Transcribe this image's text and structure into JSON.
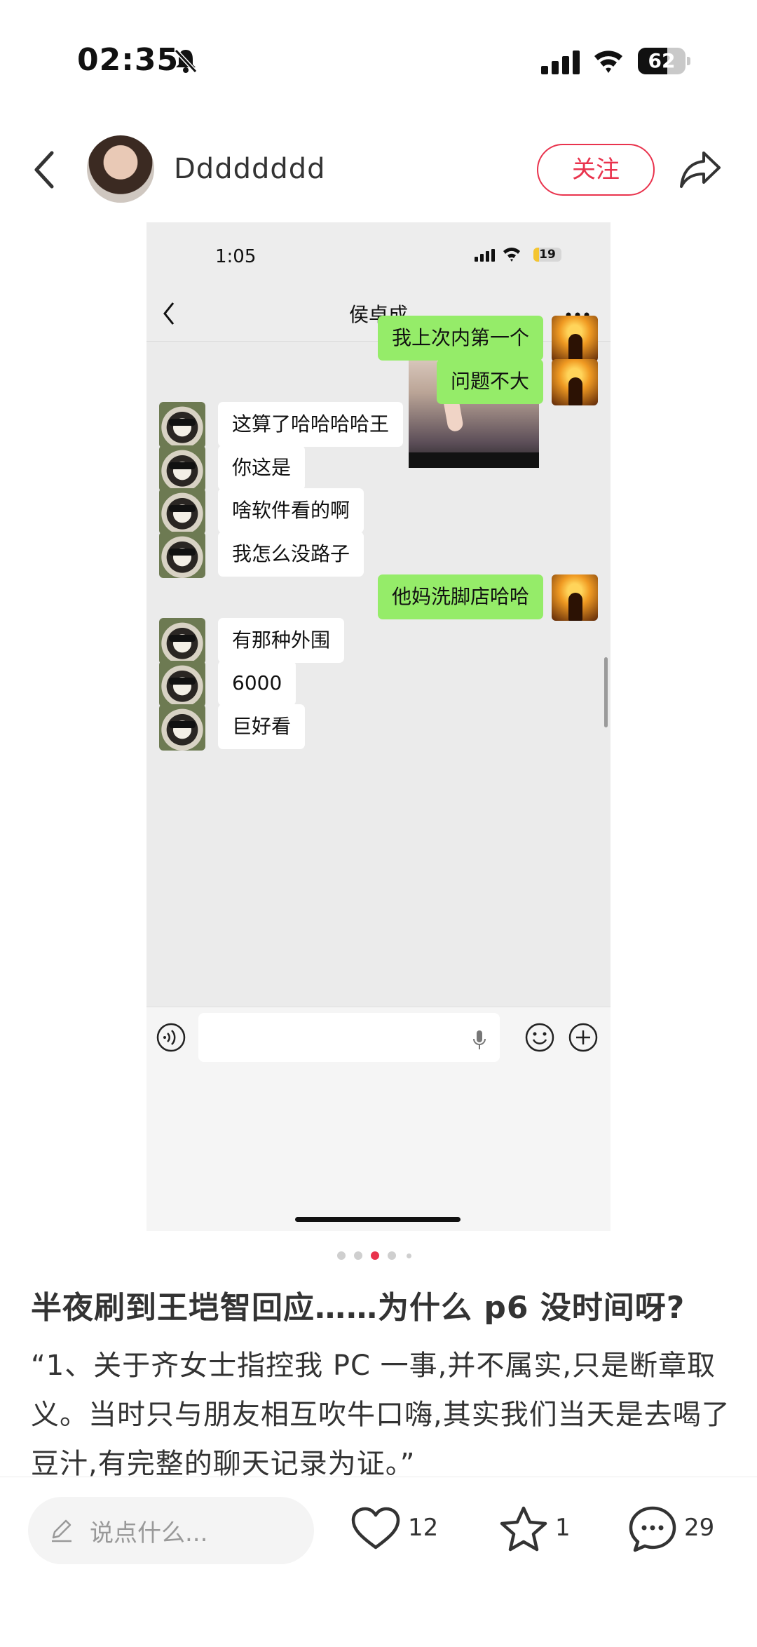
{
  "status_bar": {
    "time": "02:35",
    "battery": "62",
    "battery_level": 0.62
  },
  "header": {
    "author": "Dddddddd",
    "follow_label": "关注"
  },
  "screenshot": {
    "status_time": "1:05",
    "battery": "19",
    "battery_level": 0.19,
    "chat_title": "侯卓成",
    "messages": [
      {
        "side": "out",
        "text": "我上次内第一个"
      },
      {
        "side": "out",
        "text": "问题不大"
      },
      {
        "side": "in",
        "text": "这算了哈哈哈哈王"
      },
      {
        "side": "in",
        "text": "你这是"
      },
      {
        "side": "in",
        "text": "啥软件看的啊"
      },
      {
        "side": "in",
        "text": "我怎么没路子"
      },
      {
        "side": "out",
        "text": "他妈洗脚店哈哈"
      },
      {
        "side": "in",
        "text": "有那种外围"
      },
      {
        "side": "in",
        "text": "6000"
      },
      {
        "side": "in",
        "text": "巨好看"
      }
    ]
  },
  "carousel": {
    "count": 5,
    "active_index": 2
  },
  "post": {
    "title": "半夜刷到王垲智回应……为什么 p6 没时间呀?",
    "body": "“1、关于齐女士指控我 PC 一事,并不属实,只是断章取义。当时只与朋友相互吹牛口嗨,其实我们当天是去喝了豆汁,有完整的聊天记录为证。”"
  },
  "bottom_bar": {
    "comment_placeholder": "说点什么...",
    "likes": "12",
    "stars": "1",
    "comments": "29"
  },
  "colors": {
    "accent": "#e9334d",
    "bubble_out": "#95ec69",
    "bubble_in": "#ffffff",
    "chat_bg": "#ebebeb"
  }
}
